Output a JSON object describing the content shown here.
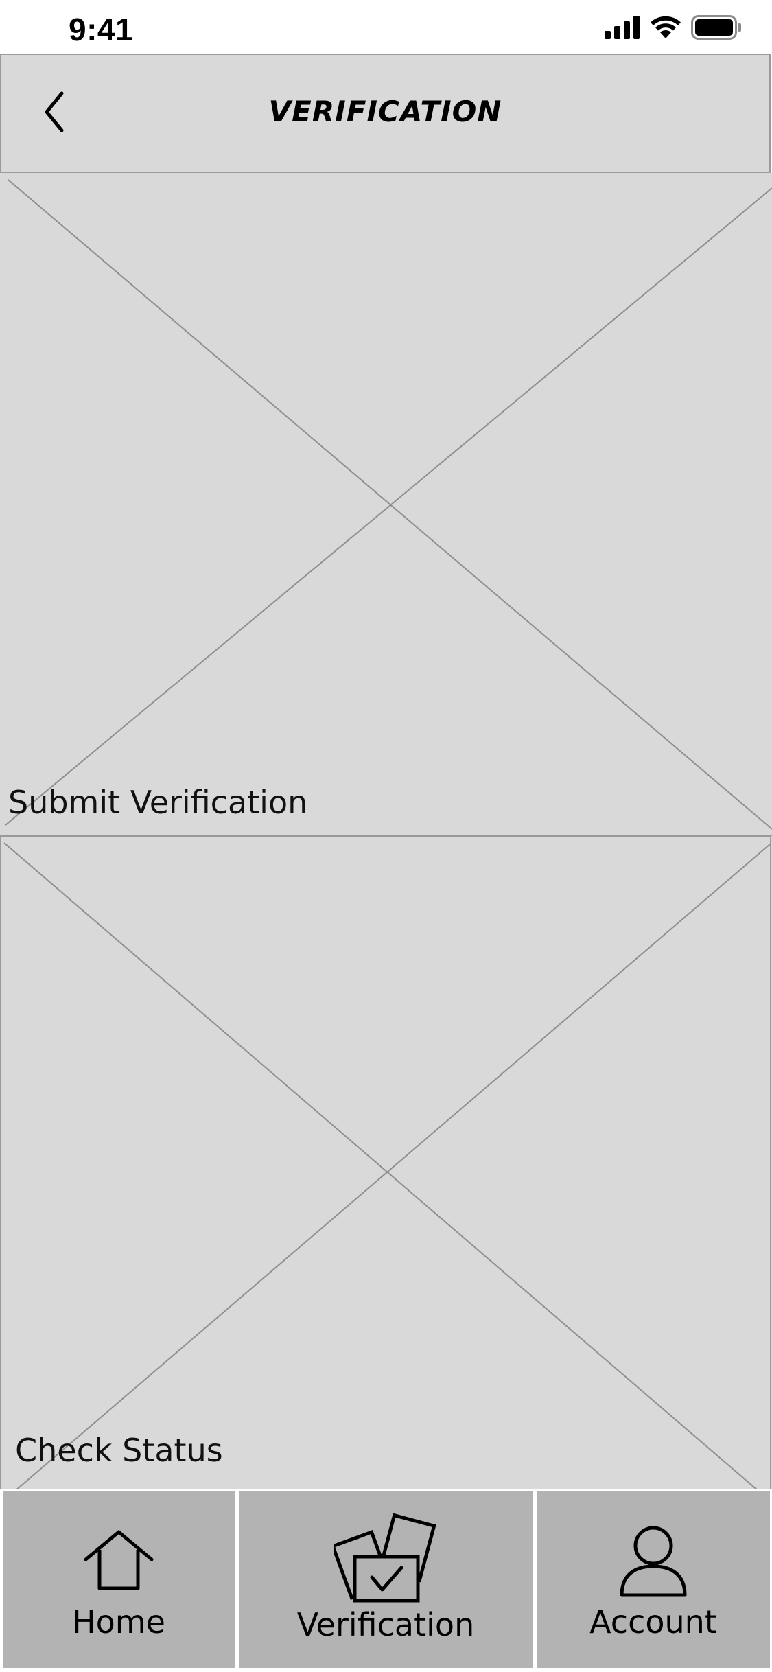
{
  "status_bar": {
    "time": "9:41",
    "icons": [
      "cellular-signal-icon",
      "wifi-icon",
      "battery-icon"
    ]
  },
  "header": {
    "title": "VERIFICATION",
    "back_icon": "chevron-left-icon"
  },
  "tiles": [
    {
      "label": "Submit Verification",
      "icon": "image-placeholder-icon"
    },
    {
      "label": "Check Status",
      "icon": "image-placeholder-icon"
    }
  ],
  "bottom_nav": {
    "items": [
      {
        "label": "Home",
        "icon": "home-icon"
      },
      {
        "label": "Verification",
        "icon": "verification-documents-icon"
      },
      {
        "label": "Account",
        "icon": "person-icon"
      }
    ]
  },
  "colors": {
    "placeholder_fill": "#d9d9d9",
    "border": "#9a9a9a",
    "nav_fill": "#b3b3b3"
  }
}
